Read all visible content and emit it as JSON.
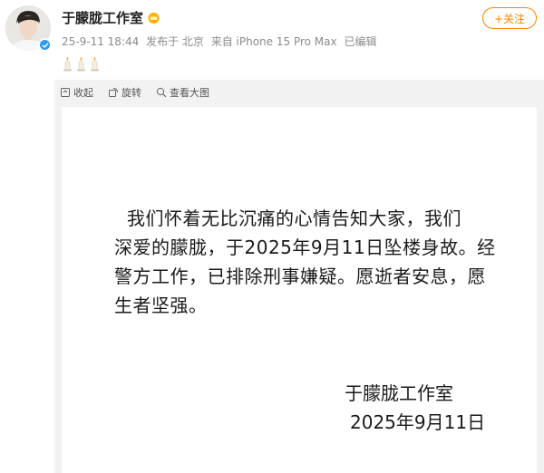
{
  "post": {
    "author": "于朦胧工作室",
    "meta": {
      "time": "25-9-11 18:44",
      "location": "发布于 北京",
      "device": "来自 iPhone 15 Pro Max",
      "edited": "已编辑"
    },
    "emoji_icon": "candle-icon",
    "follow_label": "+关注"
  },
  "image_toolbar": {
    "collapse_label": "收起",
    "rotate_label": "旋转",
    "view_large_label": "查看大图"
  },
  "statement": {
    "line1": "我们怀着无比沉痛的心情告知大家，我们",
    "line2": "深爱的朦胧，于2025年9月11日坠楼身故。经",
    "line3": "警方工作，已排除刑事嫌疑。愿逝者安息，愿",
    "line4": "生者坚强。",
    "signature": "于朦胧工作室",
    "date": "2025年9月11日"
  },
  "colors": {
    "accent": "#ff8200",
    "verified": "#2d9bf0",
    "meta_text": "#8a8a8a",
    "panel_bg": "#f2f2f2"
  }
}
